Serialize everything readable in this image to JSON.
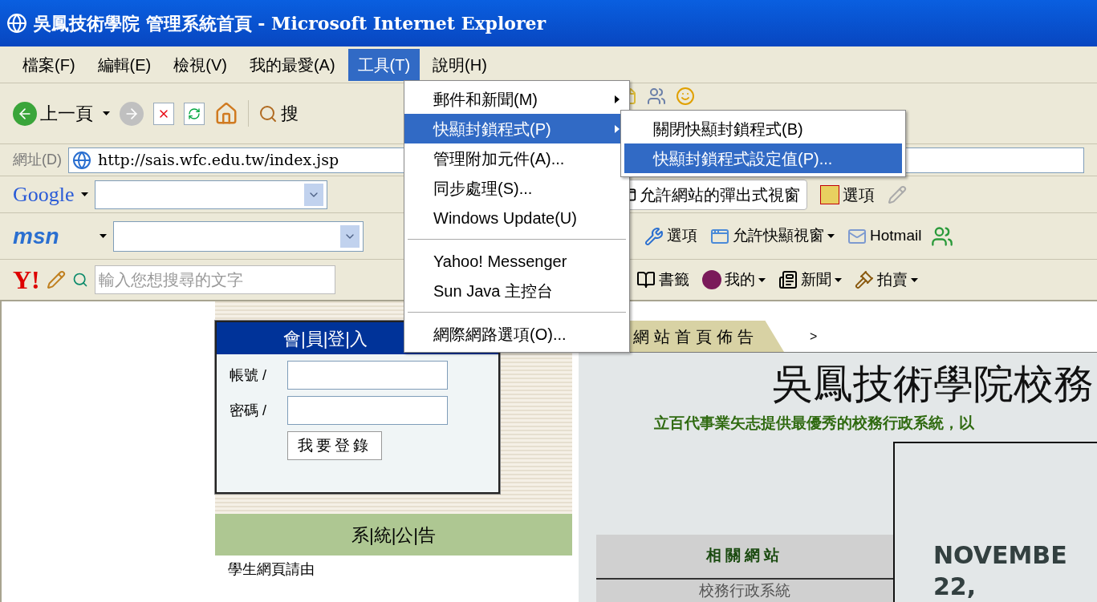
{
  "window": {
    "title": "吳鳳技術學院 管理系統首頁 - Microsoft Internet Explorer"
  },
  "menu_bar": [
    {
      "label": "檔案(F)",
      "selected": false
    },
    {
      "label": "編輯(E)",
      "selected": false
    },
    {
      "label": "檢視(V)",
      "selected": false
    },
    {
      "label": "我的最愛(A)",
      "selected": false
    },
    {
      "label": "工具(T)",
      "selected": true
    },
    {
      "label": "說明(H)",
      "selected": false
    }
  ],
  "toolbar": {
    "back_label": "上一頁",
    "search_label": "搜"
  },
  "address": {
    "label": "網址(D)",
    "value": "http://sais.wfc.edu.tw/index.jsp"
  },
  "google_bar": {
    "logo": "Google",
    "buttons": [
      "允許網站的彈出式視窗",
      "選項"
    ]
  },
  "msn_bar": {
    "logo": "msn",
    "buttons": [
      "選項",
      "允許快顯視窗",
      "Hotmail"
    ]
  },
  "yahoo_bar": {
    "logo": "Y!",
    "placeholder": "輸入您想搜尋的文字",
    "buttons": [
      "書籤",
      "我的",
      "新聞",
      "拍賣"
    ]
  },
  "tools_menu": {
    "items": [
      {
        "kind": "item",
        "label": "郵件和新聞(M)",
        "submenu": true,
        "selected": false
      },
      {
        "kind": "item",
        "label": "快顯封鎖程式(P)",
        "submenu": true,
        "selected": true
      },
      {
        "kind": "item",
        "label": "管理附加元件(A)...",
        "submenu": false,
        "selected": false
      },
      {
        "kind": "item",
        "label": "同步處理(S)...",
        "submenu": false,
        "selected": false
      },
      {
        "kind": "item",
        "label": "Windows Update(U)",
        "submenu": false,
        "selected": false
      },
      {
        "kind": "separator"
      },
      {
        "kind": "item",
        "label": "Yahoo! Messenger",
        "submenu": false,
        "selected": false
      },
      {
        "kind": "item",
        "label": "Sun Java 主控台",
        "submenu": false,
        "selected": false
      },
      {
        "kind": "separator"
      },
      {
        "kind": "item",
        "label": "網際網路選項(O)...",
        "submenu": false,
        "selected": false
      }
    ]
  },
  "popup_submenu": {
    "items": [
      {
        "label": "關閉快顯封鎖程式(B)",
        "selected": false
      },
      {
        "label": "快顯封鎖程式設定值(P)...",
        "selected": true
      }
    ]
  },
  "login": {
    "title": "會|員|登|入",
    "fields": [
      {
        "label": "帳號 /"
      },
      {
        "label": "密碼 /"
      }
    ],
    "submit": "我要登錄"
  },
  "announcements": {
    "title": "系|統|公|告",
    "first_line": "學生網頁請由"
  },
  "notice_panel": {
    "tab": "網站首頁佈告",
    "breadcrumb": ">",
    "heading": "吳鳳技術學院校務",
    "slogan": "立百代事業矢志提供最優秀的校務行政系統，以",
    "related": {
      "title": "相關網站",
      "links": [
        "校務行政系統"
      ]
    },
    "date": [
      "NOVEMBE",
      "22,"
    ]
  }
}
